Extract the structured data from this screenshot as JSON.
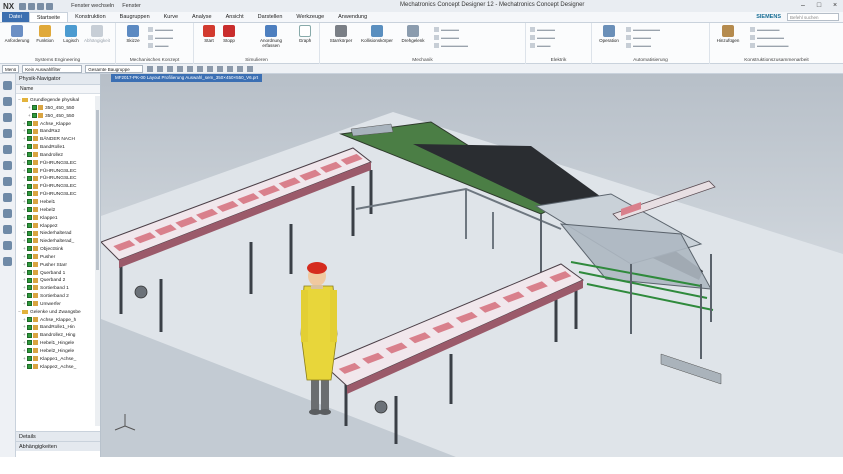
{
  "app": {
    "logo": "NX",
    "window_title": "Mechatronics Concept Designer 12 - Mechatronics Concept Designer",
    "window_switch": [
      "Fenster wechseln",
      "Fenster"
    ],
    "brand": "SIEMENS",
    "search_placeholder": "Befehl suchen"
  },
  "menu_tabs": [
    "Datei",
    "Startseite",
    "Konstruktion",
    "Baugruppen",
    "Kurve",
    "Analyse",
    "Ansicht",
    "Darstellen",
    "Werkzeuge",
    "Anwendung"
  ],
  "ribbon": {
    "groups": {
      "systems": "Systems Engineering",
      "mech_concept": "Mechanisches Konzept",
      "simulate": "Simulieren",
      "mechanik": "Mechanik",
      "elektrik": "Elektrik",
      "automation": "Automatisierung",
      "assembly": "Konstruktionszusammenarbeit"
    },
    "buttons": {
      "anforderung": "Anforderung",
      "funktion": "Funktion",
      "logisch": "Logisch",
      "abhaengigkeit": "Abhängigkeit",
      "skizze": "Skizze",
      "start": "Start",
      "stopp": "Stopp",
      "anordnung": "Anordnung erfassen",
      "graph": "Graph",
      "starrkoerper": "Starrkörper",
      "kollision": "Kollisionskörper",
      "drehgelenk": "Drehgelenk",
      "operation": "Operation",
      "hinzufuegen": "Hinzufügen"
    }
  },
  "selection_bar": {
    "menu": "Menü",
    "filter": "Kein Auswahlfilter",
    "scope": "Gesamte Baugruppe"
  },
  "navigator": {
    "title": "Physik-Navigator",
    "column": "Name",
    "rows": [
      {
        "label": "Grundlegende physikal",
        "kind": "folder",
        "indent": 0
      },
      {
        "label": "350_450_550",
        "kind": "part",
        "indent": 2
      },
      {
        "label": "350_450_550",
        "kind": "part",
        "indent": 2
      },
      {
        "label": "Achse_Klappe",
        "kind": "item",
        "indent": 1
      },
      {
        "label": "BandRa2",
        "kind": "item",
        "indent": 1
      },
      {
        "label": "BÄNDER NACH",
        "kind": "item",
        "indent": 1
      },
      {
        "label": "BandRolle1",
        "kind": "item",
        "indent": 1
      },
      {
        "label": "Bandrolle2",
        "kind": "item",
        "indent": 1
      },
      {
        "label": "FÜHRUNGSLEC",
        "kind": "item",
        "indent": 1
      },
      {
        "label": "FÜHRUNGSLEC",
        "kind": "item",
        "indent": 1
      },
      {
        "label": "FÜHRUNGSLEC",
        "kind": "item",
        "indent": 1
      },
      {
        "label": "FÜHRUNGSLEC",
        "kind": "item",
        "indent": 1
      },
      {
        "label": "FÜHRUNGSLEC",
        "kind": "item",
        "indent": 1
      },
      {
        "label": "Hebel1",
        "kind": "item",
        "indent": 1
      },
      {
        "label": "Hebel2",
        "kind": "item",
        "indent": 1
      },
      {
        "label": "Klappe1",
        "kind": "item",
        "indent": 1
      },
      {
        "label": "Klappe2",
        "kind": "item",
        "indent": 1
      },
      {
        "label": "Niederhalterad",
        "kind": "item",
        "indent": 1
      },
      {
        "label": "Niederhalterad_",
        "kind": "item",
        "indent": 1
      },
      {
        "label": "ObjectSink",
        "kind": "item",
        "indent": 1
      },
      {
        "label": "Pusher",
        "kind": "item",
        "indent": 1
      },
      {
        "label": "Pusher Starr",
        "kind": "item",
        "indent": 1
      },
      {
        "label": "Querband 1",
        "kind": "item",
        "indent": 1
      },
      {
        "label": "Querband 2",
        "kind": "item",
        "indent": 1
      },
      {
        "label": "Sortierband 1",
        "kind": "item",
        "indent": 1
      },
      {
        "label": "Sortierband 2",
        "kind": "item",
        "indent": 1
      },
      {
        "label": "Umwerfer",
        "kind": "item",
        "indent": 1
      },
      {
        "label": "Gelenke und Zwangsbe",
        "kind": "folder",
        "indent": 0
      },
      {
        "label": "Achse_Klappe_h",
        "kind": "item",
        "indent": 1
      },
      {
        "label": "BandRolle1_Hin",
        "kind": "item",
        "indent": 1
      },
      {
        "label": "Bandrolle2_Hing",
        "kind": "item",
        "indent": 1
      },
      {
        "label": "Hebel1_Hingele",
        "kind": "item",
        "indent": 1
      },
      {
        "label": "Hebel2_Hingele",
        "kind": "item",
        "indent": 1
      },
      {
        "label": "Klappe1_Achse_",
        "kind": "item",
        "indent": 1
      },
      {
        "label": "Klappe2_Achse_",
        "kind": "item",
        "indent": 1
      }
    ],
    "footer": [
      "Details",
      "Abhängigkeiten"
    ]
  },
  "viewport": {
    "tab": "MF2017-PK-00 Layout Profilierung Auswahl_sem_350×450×550_V6.prt"
  },
  "colors": {
    "accent": "#3c6fb0",
    "belt_red": "#d9808c",
    "belt_surface": "#f2e8ec",
    "floor": "#d8dde3",
    "frame": "#3c4148",
    "green": "#2f8a3c",
    "helmet": "#d52b1e",
    "shirt": "#e8d63a"
  }
}
